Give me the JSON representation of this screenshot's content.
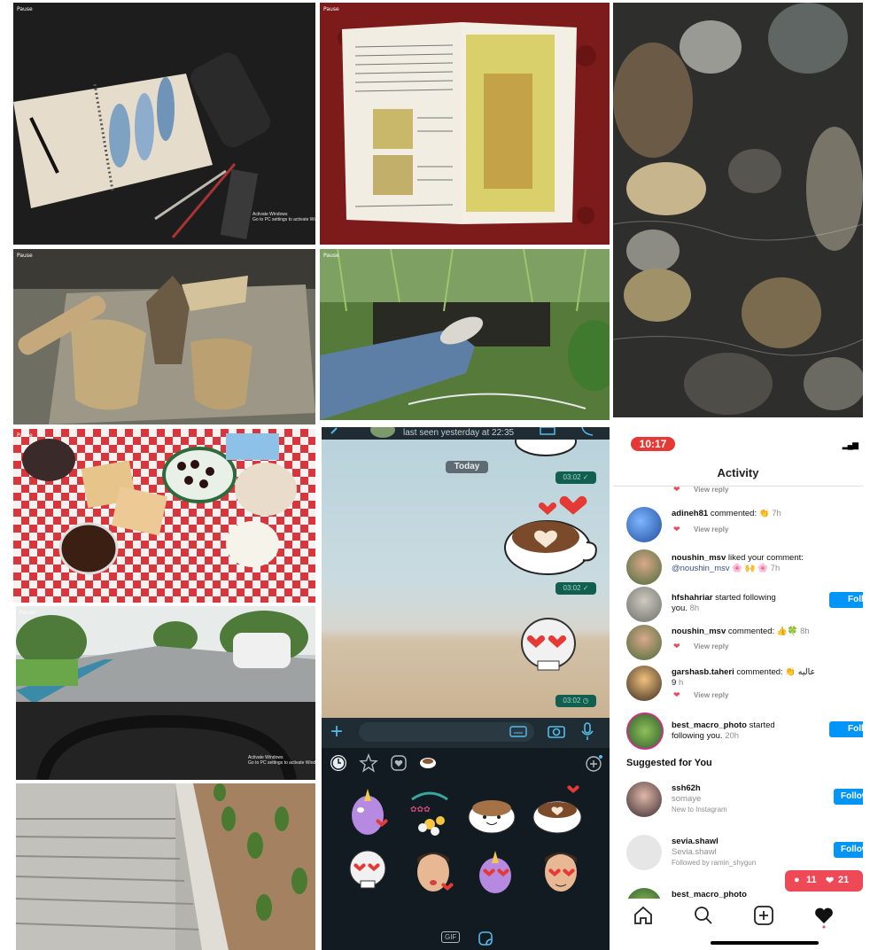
{
  "grid": {
    "pause_label": "Pause",
    "watermark": "Activate Windows\nGo to PC settings to activate Windows"
  },
  "whatsapp": {
    "last_seen": "last seen yesterday at 22:35",
    "date_chip": "Today",
    "message_times": [
      "03:02 ✓",
      "03:02 ✓",
      "03:02 ◷"
    ],
    "buttons": {
      "attach": "+",
      "gif": "GIF"
    },
    "sticker_tabs": [
      "recent-icon",
      "star-icon",
      "heart-icon",
      "coffee-icon",
      "add-icon"
    ],
    "stickers": [
      "unicorn-kiss",
      "flower-text",
      "happy-coffee",
      "coffee-heart-latte",
      "heart-eyes-skull",
      "kiss-memoji",
      "heart-eyes-unicorn",
      "heart-eyes-memoji"
    ]
  },
  "instagram": {
    "status_time": "10:17",
    "header": "Activity",
    "view_reply": "View reply",
    "activities": [
      {
        "user": "adineh81",
        "action": "commented: 👏",
        "time": "7h"
      },
      {
        "user": "noushin_msv",
        "action": "liked your comment:",
        "mention": "@noushin_msv 🌸 🙌 🌸",
        "time": "7h"
      },
      {
        "user": "hfshahriar",
        "action": "started following",
        "action2": "you.",
        "time": "8h",
        "button": "Follow"
      },
      {
        "user": "noushin_msv",
        "action": "commented: 👍🍀",
        "time": "8h"
      },
      {
        "user": "garshasb.taheri",
        "action": "commented: 👏 عالیه",
        "action2": "9",
        "time": "h"
      },
      {
        "user": "best_macro_photo",
        "action": "started",
        "action2": "following you.",
        "time": "20h",
        "button": "Follow"
      }
    ],
    "suggested_title": "Suggested for You",
    "suggestions": [
      {
        "user": "ssh62h",
        "name": "somaye",
        "note": "New to Instagram",
        "button": "Follow"
      },
      {
        "user": "sevia.shawl",
        "name": "Sevia.shawl",
        "note": "Followed by ramin_shygun",
        "button": "Follow"
      },
      {
        "user": "best_macro_photo",
        "name": "",
        "note": "",
        "button": "Follow"
      }
    ],
    "notification": {
      "comments": "11",
      "likes": "21"
    },
    "nav_icons": [
      "home-icon",
      "search-icon",
      "new-post-icon",
      "activity-heart-icon"
    ]
  },
  "colors": {
    "instagram_blue": "#0095f6",
    "instagram_red": "#ed4956",
    "whatsapp_green": "#125e4f",
    "whatsapp_accent": "#53bdeb"
  }
}
